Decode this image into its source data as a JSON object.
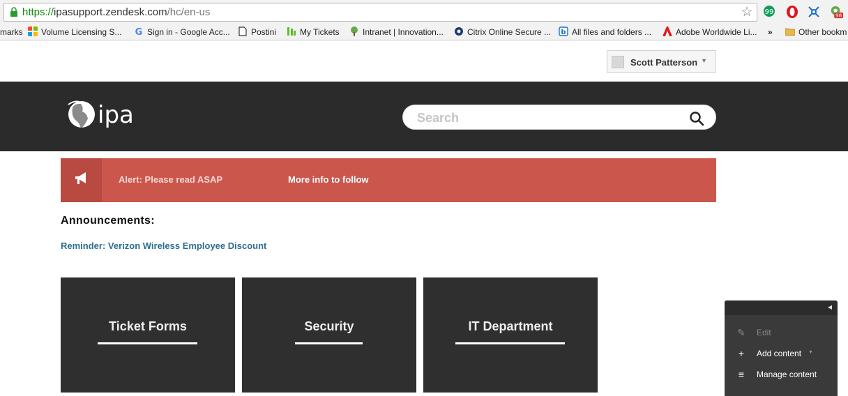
{
  "browser": {
    "url_scheme": "https://",
    "url_host": "ipasupport.zendesk.com",
    "url_path": "/hc/en-us",
    "extension_badge": "98"
  },
  "bookmarks": [
    {
      "label": "marks",
      "icon": "bookmark-icon"
    },
    {
      "label": "Volume Licensing S...",
      "icon": "windows-icon"
    },
    {
      "label": "Sign in - Google Acc...",
      "icon": "google-icon"
    },
    {
      "label": "Postini",
      "icon": "page-icon"
    },
    {
      "label": "My Tickets",
      "icon": "tickets-icon"
    },
    {
      "label": "Intranet | Innovation...",
      "icon": "tree-icon"
    },
    {
      "label": "Citrix Online Secure ...",
      "icon": "gear-icon"
    },
    {
      "label": "All files and folders ...",
      "icon": "box-icon"
    },
    {
      "label": "Adobe Worldwide Li...",
      "icon": "adobe-icon"
    }
  ],
  "bookmarks_overflow": "»",
  "other_bookmarks": "Other bookm",
  "user": {
    "name": "Scott Patterson"
  },
  "search": {
    "placeholder": "Search"
  },
  "alert": {
    "title": "Alert: Please read ASAP",
    "more": "More info to follow"
  },
  "announcements": {
    "heading": "Announcements:",
    "link": "Reminder: Verizon Wireless Employee Discount"
  },
  "tiles": [
    {
      "label": "Ticket Forms"
    },
    {
      "label": "Security"
    },
    {
      "label": "IT Department"
    }
  ],
  "admin_menu": {
    "items": [
      {
        "label": "Edit",
        "icon": "pencil-icon",
        "disabled": true
      },
      {
        "label": "Add content",
        "icon": "plus-icon"
      },
      {
        "label": "Manage content",
        "icon": "manage-icon"
      }
    ]
  }
}
